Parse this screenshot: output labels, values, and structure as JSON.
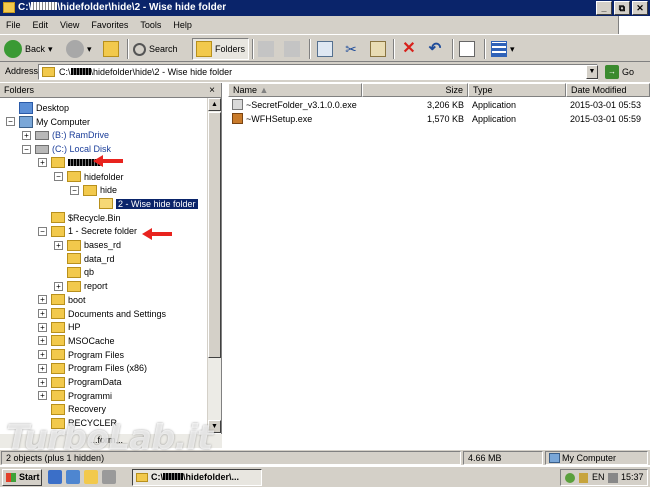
{
  "window": {
    "title": "C:\\████\\hidefolder\\hide\\2 - Wise hide folder",
    "title_prefix": "C:\\",
    "title_suffix": "\\hidefolder\\hide\\2 - Wise hide folder"
  },
  "menu": [
    "File",
    "Edit",
    "View",
    "Favorites",
    "Tools",
    "Help"
  ],
  "toolbar": {
    "back": "Back",
    "search": "Search",
    "folders": "Folders"
  },
  "address": {
    "label": "Address",
    "prefix": "C:\\",
    "suffix": "\\hidefolder\\hide\\2 - Wise hide folder",
    "go": "Go"
  },
  "folders_pane": {
    "title": "Folders",
    "close": "×",
    "tree": [
      {
        "label": "Desktop",
        "expander": "",
        "icon": "desktop"
      },
      {
        "label": "My Computer",
        "expander": "−",
        "icon": "computer"
      },
      {
        "label": "(B:) RamDrive",
        "expander": "+",
        "icon": "drive"
      },
      {
        "label": "(C:) Local Disk",
        "expander": "−",
        "icon": "drive"
      },
      {
        "label": "",
        "expander": "+",
        "icon": "folder"
      },
      {
        "label": "hidefolder",
        "expander": "−",
        "icon": "folder"
      },
      {
        "label": "hide",
        "expander": "−",
        "icon": "folder"
      },
      {
        "label": "2 - Wise hide folder",
        "expander": "",
        "icon": "folder-open"
      },
      {
        "label": "$Recycle.Bin",
        "expander": "",
        "icon": "folder"
      },
      {
        "label": "1 - Secrete folder",
        "expander": "−",
        "icon": "folder"
      },
      {
        "label": "bases_rd",
        "expander": "+",
        "icon": "folder"
      },
      {
        "label": "data_rd",
        "expander": "",
        "icon": "folder"
      },
      {
        "label": "qb",
        "expander": "",
        "icon": "folder"
      },
      {
        "label": "report",
        "expander": "+",
        "icon": "folder"
      },
      {
        "label": "boot",
        "expander": "+",
        "icon": "folder"
      },
      {
        "label": "Documents and Settings",
        "expander": "+",
        "icon": "folder"
      },
      {
        "label": "HP",
        "expander": "+",
        "icon": "folder"
      },
      {
        "label": "MSOCache",
        "expander": "+",
        "icon": "folder"
      },
      {
        "label": "Program Files",
        "expander": "+",
        "icon": "folder"
      },
      {
        "label": "Program Files (x86)",
        "expander": "+",
        "icon": "folder"
      },
      {
        "label": "ProgramData",
        "expander": "+",
        "icon": "folder"
      },
      {
        "label": "Programmi",
        "expander": "+",
        "icon": "folder"
      },
      {
        "label": "Recovery",
        "expander": "",
        "icon": "folder"
      },
      {
        "label": "RECYCLER",
        "expander": "",
        "icon": "folder"
      }
    ],
    "partial_row": "...form..."
  },
  "files": {
    "columns": [
      "Name",
      "Size",
      "Type",
      "Date Modified"
    ],
    "rows": [
      {
        "name": "~SecretFolder_v3.1.0.0.exe",
        "size": "3,206 KB",
        "type": "Application",
        "date": "2015-03-01 05:53"
      },
      {
        "name": "~WFHSetup.exe",
        "size": "1,570 KB",
        "type": "Application",
        "date": "2015-03-01 05:59"
      }
    ]
  },
  "status": {
    "objects": "2 objects (plus 1 hidden)",
    "size": "4.66 MB",
    "location": "My Computer"
  },
  "watermark": "TurboLab.it",
  "taskbar": {
    "start": "Start",
    "task_prefix": "C:\\",
    "task_suffix": "\\hidefolder\\...",
    "lang": "EN",
    "time": "15:37"
  },
  "colors": {
    "titlebar": "#0a246a",
    "selection": "#0a246a",
    "annotation_arrow": "#e8231e",
    "folder_yellow": "#f2c94c"
  }
}
